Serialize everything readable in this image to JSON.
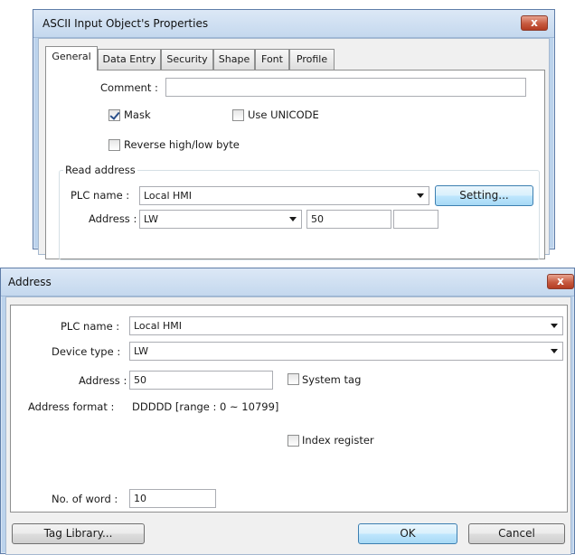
{
  "props_dialog": {
    "title": "ASCII Input Object's Properties",
    "close_label": "x",
    "tabs": [
      "General",
      "Data Entry",
      "Security",
      "Shape",
      "Font",
      "Profile"
    ],
    "comment_label": "Comment :",
    "comment_value": "",
    "mask_label": "Mask",
    "mask_checked": true,
    "unicode_label": "Use UNICODE",
    "unicode_checked": false,
    "reverse_label": "Reverse high/low byte",
    "reverse_checked": false,
    "read_address": {
      "group_label": "Read address",
      "plc_label": "PLC name :",
      "plc_value": "Local HMI",
      "setting_label": "Setting...",
      "address_label": "Address :",
      "device_value": "LW",
      "address_value": "50"
    }
  },
  "address_dialog": {
    "title": "Address",
    "close_label": "x",
    "plc_label": "PLC name :",
    "plc_value": "Local HMI",
    "device_type_label": "Device type :",
    "device_type_value": "LW",
    "address_label": "Address :",
    "address_value": "50",
    "system_tag_label": "System tag",
    "system_tag_checked": false,
    "address_format_label": "Address format :",
    "address_format_value": "DDDDD [range : 0 ~ 10799]",
    "index_register_label": "Index register",
    "index_register_checked": false,
    "words_label": "No. of word :",
    "words_value": "10",
    "tag_library_label": "Tag Library...",
    "ok_label": "OK",
    "cancel_label": "Cancel"
  }
}
